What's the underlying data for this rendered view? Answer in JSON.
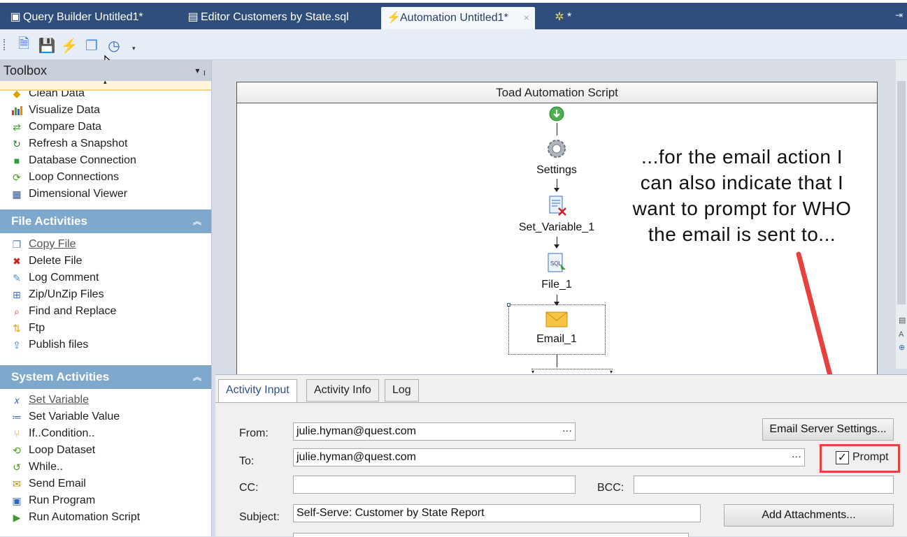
{
  "tabs": [
    {
      "label": "Query Builder Untitled1*",
      "icon": "query-builder-icon"
    },
    {
      "label": "Editor Customers by State.sql",
      "icon": "editor-icon"
    },
    {
      "label": "Automation Untitled1*",
      "icon": "lightning-icon",
      "close": "×"
    },
    {
      "label": "*",
      "icon": "project-icon"
    }
  ],
  "toolbox": {
    "title": "Toolbox",
    "top_items": [
      {
        "label": "Clean Data",
        "icon": "clean-data-icon"
      },
      {
        "label": "Visualize Data",
        "icon": "chart-icon"
      },
      {
        "label": "Compare Data",
        "icon": "compare-icon"
      },
      {
        "label": "Refresh a Snapshot",
        "icon": "refresh-icon"
      },
      {
        "label": "Database Connection",
        "icon": "database-icon"
      },
      {
        "label": "Loop Connections",
        "icon": "loop-icon"
      },
      {
        "label": "Dimensional Viewer",
        "icon": "dimensional-icon"
      }
    ],
    "file_section": "File Activities",
    "file_items": [
      {
        "label": "Copy File",
        "icon": "copy-file-icon"
      },
      {
        "label": "Delete File",
        "icon": "delete-file-icon"
      },
      {
        "label": "Log Comment",
        "icon": "comment-icon"
      },
      {
        "label": "Zip/UnZip Files",
        "icon": "zip-icon"
      },
      {
        "label": "Find and Replace",
        "icon": "find-replace-icon"
      },
      {
        "label": "Ftp",
        "icon": "ftp-icon"
      },
      {
        "label": "Publish files",
        "icon": "publish-icon"
      }
    ],
    "system_section": "System Activities",
    "system_items": [
      {
        "label": "Set Variable",
        "icon": "variable-icon"
      },
      {
        "label": "Set Variable Value",
        "icon": "variable-value-icon"
      },
      {
        "label": "If..Condition..",
        "icon": "condition-icon"
      },
      {
        "label": "Loop Dataset",
        "icon": "loop-dataset-icon"
      },
      {
        "label": "While..",
        "icon": "while-icon"
      },
      {
        "label": "Send Email",
        "icon": "email-icon"
      },
      {
        "label": "Run Program",
        "icon": "run-program-icon"
      },
      {
        "label": "Run Automation Script",
        "icon": "run-script-icon"
      }
    ]
  },
  "script": {
    "title": "Toad Automation Script",
    "nodes": [
      "Settings",
      "Set_Variable_1",
      "File_1",
      "Email_1"
    ]
  },
  "annotation": "...for the email action I can also indicate that I want to prompt for WHO the email is sent to...",
  "props": {
    "tabs": [
      "Activity Input",
      "Activity Info",
      "Log"
    ],
    "from_label": "From:",
    "from_value": "julie.hyman@quest.com",
    "to_label": "To:",
    "to_value": "julie.hyman@quest.com",
    "cc_label": "CC:",
    "bcc_label": "BCC:",
    "subject_label": "Subject:",
    "subject_value": "Self-Serve: Customer by State Report",
    "email_server_button": "Email Server Settings...",
    "add_attachments_button": "Add Attachments...",
    "prompt_label": "Prompt",
    "prompt_checked": true,
    "dots": "···"
  },
  "colors": {
    "annotation_arrow": "#e8403e",
    "tab_bar": "#2f4e7c",
    "section_header": "#7fa8cd"
  }
}
